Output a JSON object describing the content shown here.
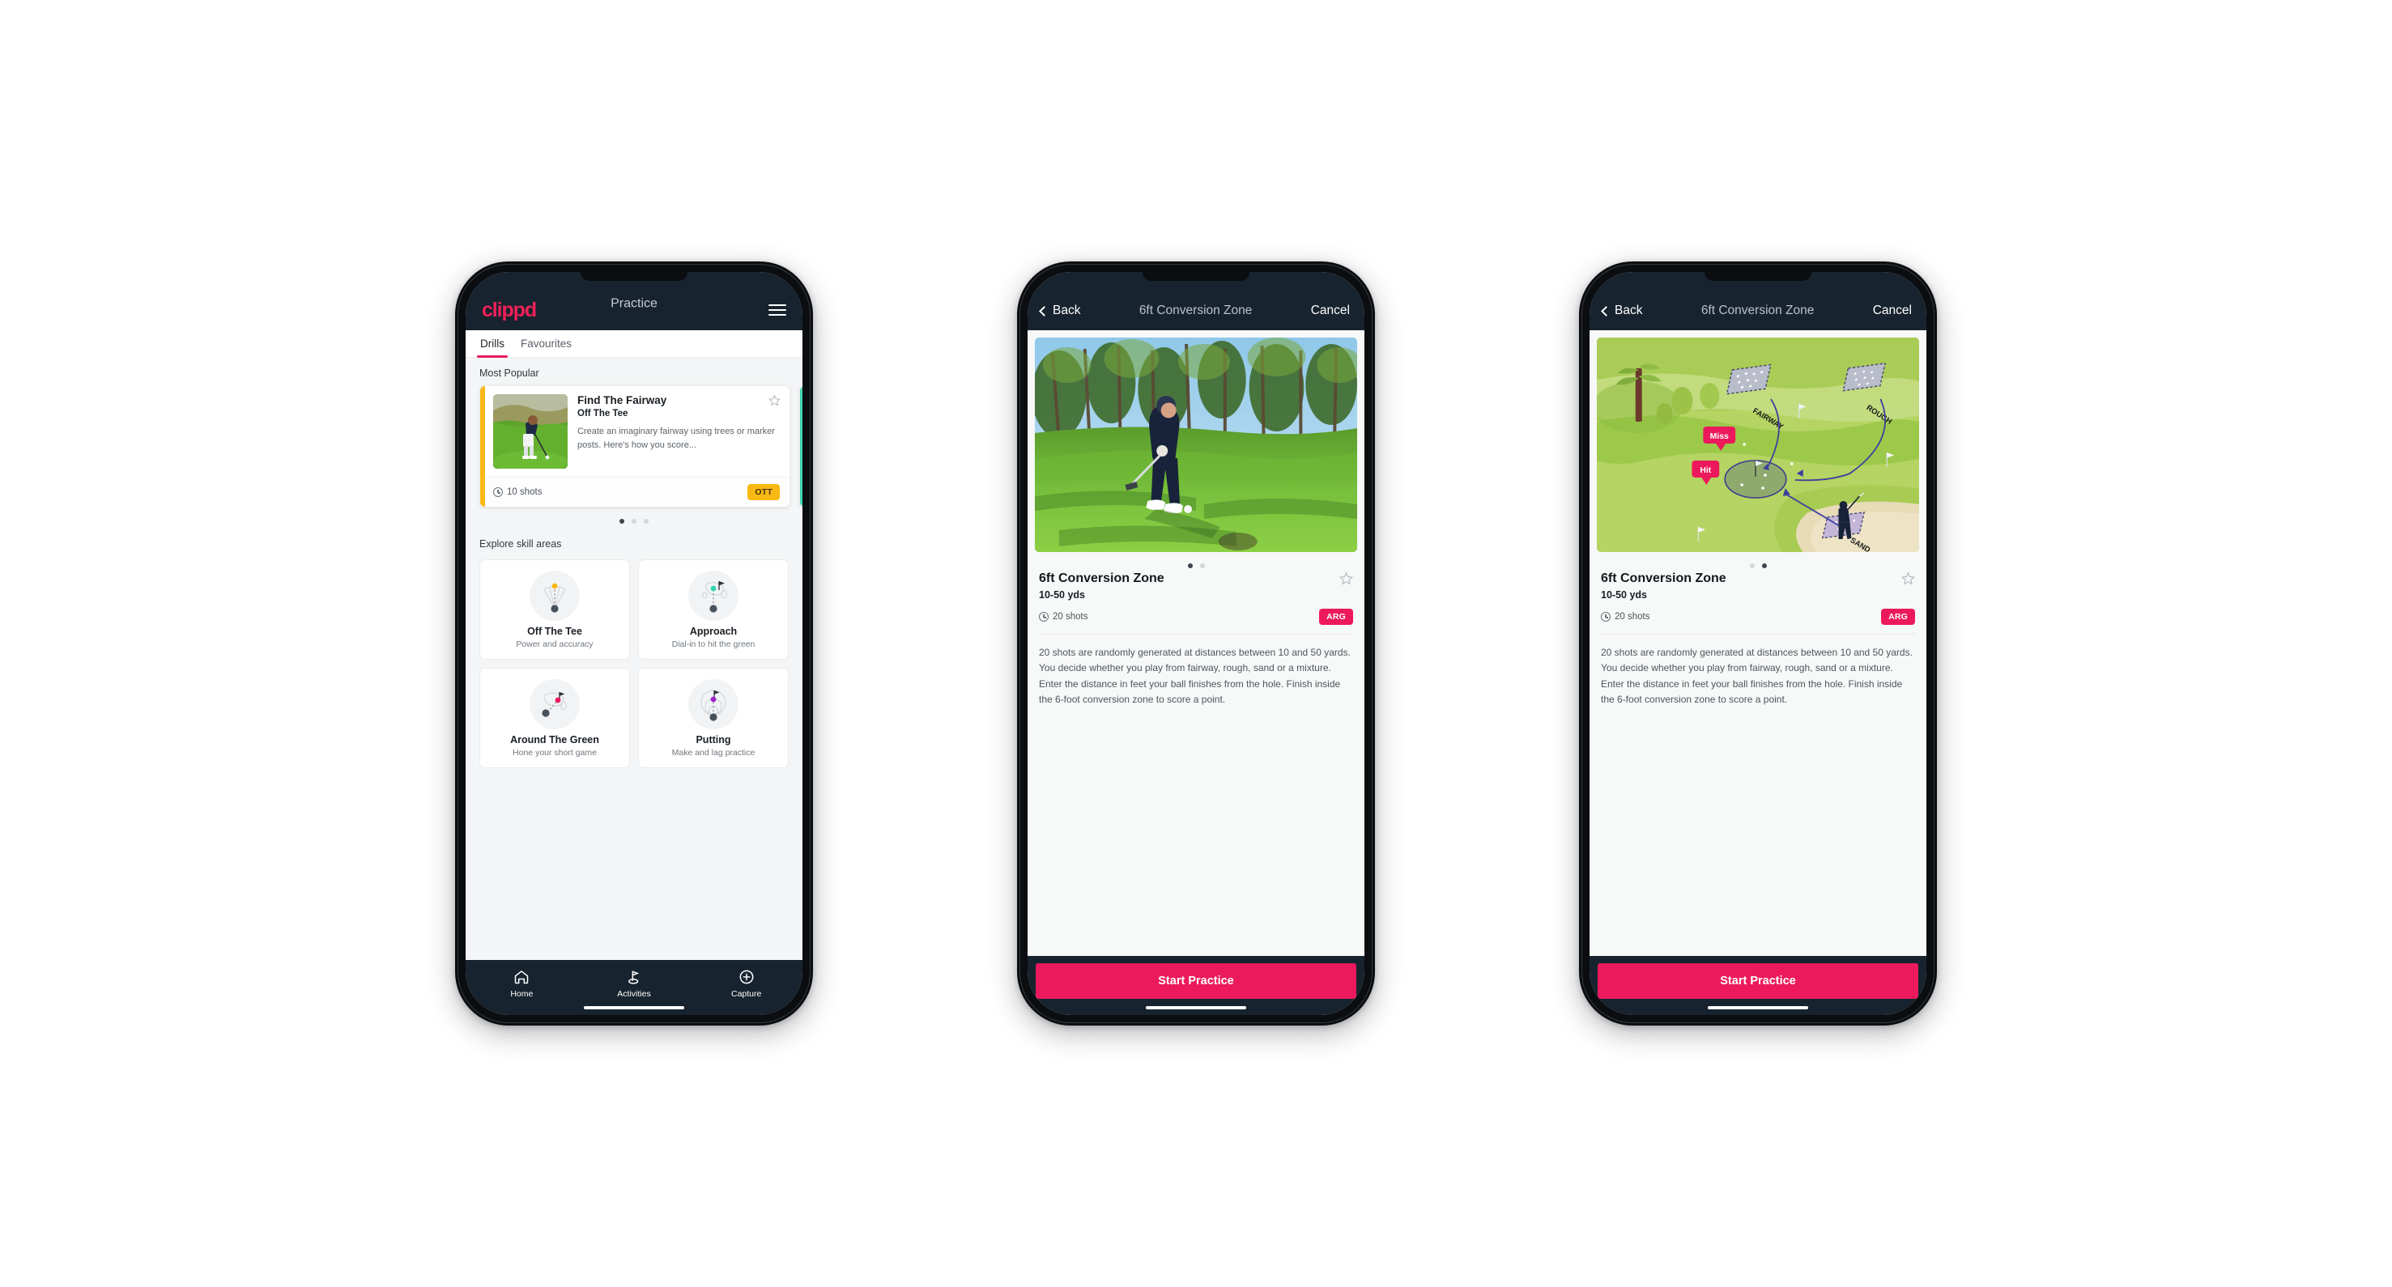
{
  "brand": {
    "name": "clippd",
    "accent_pink": "#ec1a5c",
    "navy": "#17232e",
    "amber": "#f9b915",
    "teal": "#3fd4b0"
  },
  "phone1": {
    "header": {
      "logo": "clippd",
      "title": "Practice",
      "menu_icon": "hamburger-icon"
    },
    "tabs": [
      {
        "label": "Drills",
        "active": true
      },
      {
        "label": "Favourites",
        "active": false
      }
    ],
    "most_popular_label": "Most Popular",
    "drill_card": {
      "title": "Find The Fairway",
      "subtitle": "Off The Tee",
      "description": "Create an imaginary fairway using trees or marker posts. Here's how you score...",
      "shots": "10 shots",
      "tag": "OTT",
      "tag_color": "#f9b915",
      "stripe_color": "#f9b915",
      "favourite_icon": "star-outline-icon"
    },
    "carousel_dots": {
      "count": 3,
      "active_index": 0
    },
    "explore_label": "Explore skill areas",
    "skill_areas": [
      {
        "name": "Off The Tee",
        "desc": "Power and accuracy",
        "icon": "tee-fan-icon",
        "dot_color": "#f9b915"
      },
      {
        "name": "Approach",
        "desc": "Dial-in to hit the green",
        "icon": "approach-green-icon",
        "dot_color": "#2fd6ae"
      },
      {
        "name": "Around The Green",
        "desc": "Hone your short game",
        "icon": "chip-green-icon",
        "dot_color": "#ec1a5c"
      },
      {
        "name": "Putting",
        "desc": "Make and lag practice",
        "icon": "putting-rings-icon",
        "dot_color": "#a020c8"
      }
    ],
    "bottom_nav": [
      {
        "label": "Home",
        "icon": "home-icon",
        "active": false
      },
      {
        "label": "Activities",
        "icon": "golf-flag-icon",
        "active": true
      },
      {
        "label": "Capture",
        "icon": "plus-circle-icon",
        "active": false
      }
    ]
  },
  "phone2": {
    "header": {
      "back": "Back",
      "title": "6ft Conversion Zone",
      "cancel": "Cancel",
      "back_icon": "chevron-left-icon"
    },
    "media": {
      "type": "photo",
      "alt": "golfer-chipping-photo"
    },
    "dots": {
      "count": 2,
      "active_index": 0
    },
    "detail": {
      "title": "6ft Conversion Zone",
      "subtitle": "10-50 yds",
      "shots": "20 shots",
      "tag": "ARG",
      "tag_color": "#ec1a5c",
      "favourite_icon": "star-outline-icon",
      "description": "20 shots are randomly generated at distances between 10 and 50 yards. You decide whether you play from fairway, rough, sand or a mixture. Enter the distance in feet your ball finishes from the hole. Finish inside the 6-foot conversion zone to score a point."
    },
    "cta": "Start Practice"
  },
  "phone3": {
    "header": {
      "back": "Back",
      "title": "6ft Conversion Zone",
      "cancel": "Cancel",
      "back_icon": "chevron-left-icon"
    },
    "media": {
      "type": "illustration",
      "alt": "golf-hole-diagram",
      "labels": [
        "FAIRWAY",
        "ROUGH",
        "SAND"
      ],
      "markers": [
        "Miss",
        "Hit"
      ]
    },
    "dots": {
      "count": 2,
      "active_index": 1
    },
    "detail": {
      "title": "6ft Conversion Zone",
      "subtitle": "10-50 yds",
      "shots": "20 shots",
      "tag": "ARG",
      "tag_color": "#ec1a5c",
      "favourite_icon": "star-outline-icon",
      "description": "20 shots are randomly generated at distances between 10 and 50 yards. You decide whether you play from fairway, rough, sand or a mixture. Enter the distance in feet your ball finishes from the hole. Finish inside the 6-foot conversion zone to score a point."
    },
    "cta": "Start Practice"
  }
}
